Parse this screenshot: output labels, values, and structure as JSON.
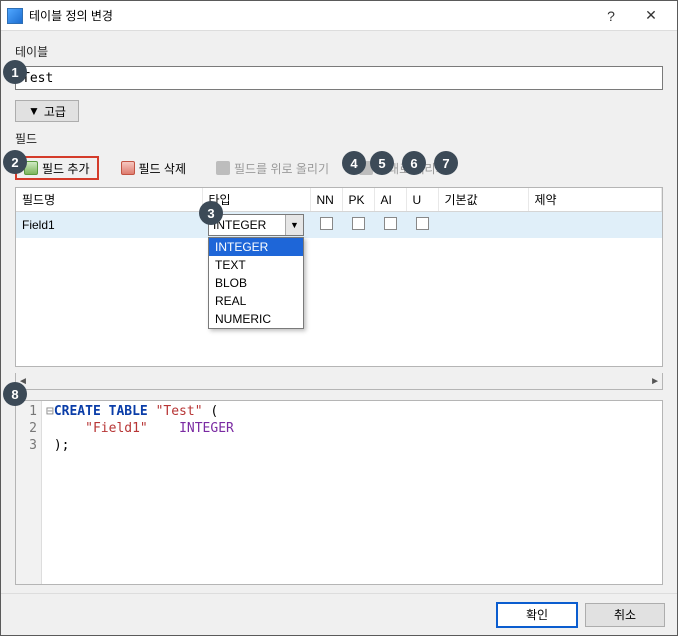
{
  "window": {
    "title": "테이블 정의 변경",
    "help": "?",
    "close": "✕"
  },
  "labels": {
    "table_section": "테이블",
    "advanced": "고급",
    "fields_section": "필드"
  },
  "table_name": "Test",
  "toolbar": {
    "add_field": "필드 추가",
    "delete_field": "필드 삭제",
    "move_up": "필드를 위로 올리기",
    "move_down": "아래로 내리기"
  },
  "columns": {
    "name": "필드명",
    "type": "타입",
    "nn": "NN",
    "pk": "PK",
    "ai": "AI",
    "u": "U",
    "default": "기본값",
    "check": "제약"
  },
  "row": {
    "name": "Field1",
    "type": "INTEGER",
    "nn": false,
    "pk": false,
    "ai": false,
    "u": false
  },
  "type_options": [
    "INTEGER",
    "TEXT",
    "BLOB",
    "REAL",
    "NUMERIC"
  ],
  "sql": {
    "lines": [
      "1",
      "2",
      "3"
    ],
    "line1_kw": "CREATE TABLE ",
    "line1_str": "\"Test\"",
    "line1_rest": " (",
    "line2_str": "\"Field1\"",
    "line2_type": "INTEGER",
    "line3": ");"
  },
  "buttons": {
    "ok": "확인",
    "cancel": "취소"
  },
  "callouts": [
    "1",
    "2",
    "3",
    "4",
    "5",
    "6",
    "7",
    "8"
  ]
}
